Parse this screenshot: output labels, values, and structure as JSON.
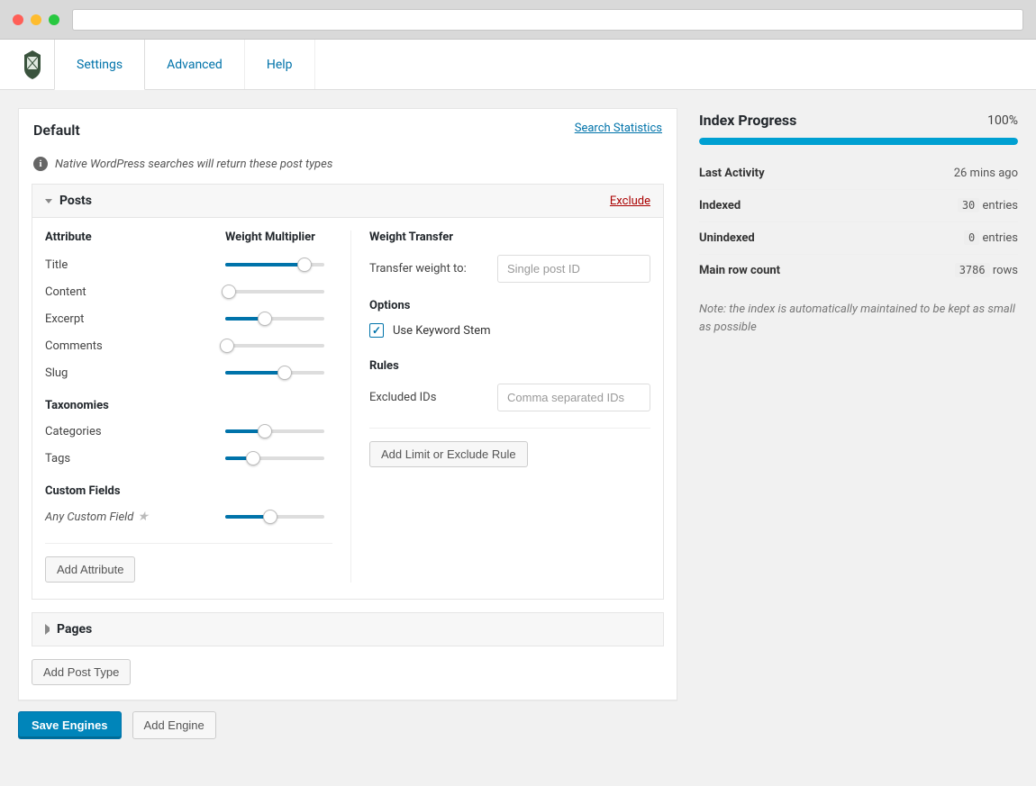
{
  "tabs": [
    "Settings",
    "Advanced",
    "Help"
  ],
  "active_tab": "Settings",
  "panel": {
    "title": "Default",
    "stats_link": "Search Statistics",
    "subhead": "Native WordPress searches will return these post types"
  },
  "posts_section": {
    "title": "Posts",
    "exclude": "Exclude",
    "head_attr": "Attribute",
    "head_mult": "Weight Multiplier",
    "attributes": [
      {
        "name": "Title",
        "value": 80
      },
      {
        "name": "Content",
        "value": 4
      },
      {
        "name": "Excerpt",
        "value": 40
      },
      {
        "name": "Comments",
        "value": 2
      },
      {
        "name": "Slug",
        "value": 60
      }
    ],
    "taxonomies_head": "Taxonomies",
    "taxonomies": [
      {
        "name": "Categories",
        "value": 40
      },
      {
        "name": "Tags",
        "value": 28
      }
    ],
    "custom_head": "Custom Fields",
    "custom": {
      "name": "Any Custom Field",
      "value": 45
    },
    "add_attr": "Add Attribute",
    "transfer_head": "Weight Transfer",
    "transfer_label": "Transfer weight to:",
    "transfer_placeholder": "Single post ID",
    "options_head": "Options",
    "option_stem": "Use Keyword Stem",
    "rules_head": "Rules",
    "rules_label": "Excluded IDs",
    "rules_placeholder": "Comma separated IDs",
    "add_rule": "Add Limit or Exclude Rule"
  },
  "pages_section": {
    "title": "Pages"
  },
  "add_post_type": "Add Post Type",
  "save_btn": "Save Engines",
  "add_engine_btn": "Add Engine",
  "sidebar": {
    "title": "Index Progress",
    "pct": "100%",
    "progress": 100,
    "rows": [
      {
        "k": "Last Activity",
        "v": "26 mins ago"
      },
      {
        "k": "Indexed",
        "code": "30",
        "suffix": "entries"
      },
      {
        "k": "Unindexed",
        "code": "0",
        "suffix": "entries"
      },
      {
        "k": "Main row count",
        "code": "3786",
        "suffix": "rows"
      }
    ],
    "note": "Note: the index is automatically maintained to be kept as small as possible"
  }
}
